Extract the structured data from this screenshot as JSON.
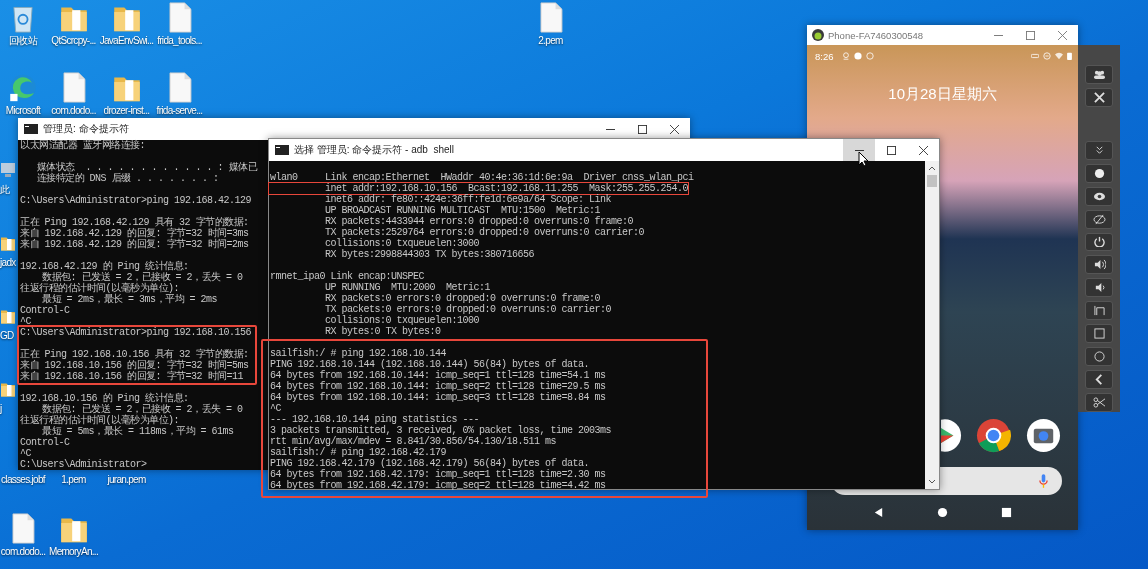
{
  "desktop": {
    "icons": [
      {
        "label": "回收站",
        "kind": "recycle"
      },
      {
        "label": "QtScrcpy-...",
        "kind": "folder"
      },
      {
        "label": "JavaEnvSwi...",
        "kind": "folder"
      },
      {
        "label": "frida_tools...",
        "kind": "file"
      },
      {
        "label": "2.pem",
        "kind": "file"
      },
      {
        "label": "Microsoft",
        "kind": "edge"
      },
      {
        "label": "com.dodo...",
        "kind": "file"
      },
      {
        "label": "drozer-inst...",
        "kind": "folder"
      },
      {
        "label": "frida-serve...",
        "kind": "file"
      },
      {
        "label": "此",
        "kind": "pc"
      },
      {
        "label": "jadx",
        "kind": "folder"
      },
      {
        "label": "GD",
        "kind": "folder"
      },
      {
        "label": "j",
        "kind": "folder"
      },
      {
        "label": "classes.jobf"
      },
      {
        "label": "1.pem"
      },
      {
        "label": "juran.pem"
      },
      {
        "label": "com.dodo...",
        "kind": "file"
      },
      {
        "label": "MemoryAn...",
        "kind": "folder"
      }
    ]
  },
  "cmd_window": {
    "title": "管理员: 命令提示符",
    "blocks": [
      [
        "以太网适配器 蓝牙网络连接:"
      ],
      [
        "   媒体状态  . . . . . . . . . . . . : 媒体已",
        "   连接特定的 DNS 后缀 . . . . . . . :"
      ],
      [
        "C:\\Users\\Administrator>ping 192.168.42.129"
      ],
      [
        "正在 Ping 192.168.42.129 具有 32 字节的数据:",
        "来自 192.168.42.129 的回复: 字节=32 时间=3ms",
        "来自 192.168.42.129 的回复: 字节=32 时间=2ms"
      ],
      [
        "192.168.42.129 的 Ping 统计信息:",
        "    数据包: 已发送 = 2，已接收 = 2，丢失 = 0",
        "往返行程的估计时间(以毫秒为单位):",
        "    最短 = 2ms，最长 = 3ms，平均 = 2ms",
        "Control-C",
        "^C",
        "C:\\Users\\Administrator>ping 192.168.10.156"
      ],
      [
        "正在 Ping 192.168.10.156 具有 32 字节的数据:",
        "来自 192.168.10.156 的回复: 字节=32 时间=5ms",
        "来自 192.168.10.156 的回复: 字节=32 时间=11"
      ],
      [
        "192.168.10.156 的 Ping 统计信息:",
        "    数据包: 已发送 = 2，已接收 = 2，丢失 = 0",
        "往返行程的估计时间(以毫秒为单位):",
        "    最短 = 5ms，最长 = 118ms，平均 = 61ms",
        "Control-C",
        "^C",
        "C:\\Users\\Administrator>"
      ]
    ]
  },
  "adb_window": {
    "title": "选择 管理员: 命令提示符 - adb  shell",
    "minimize_hovered": true,
    "blocks": [
      [
        "wlan0     Link encap:Ethernet  HWaddr 40:4e:36:1d:6e:9a  Driver cnss_wlan_pci",
        "          inet addr:192.168.10.156  Bcast:192.168.11.255  Mask:255.255.254.0",
        "          inet6 addr: fe80::424e:36ff:fe1d:6e9a/64 Scope: Link",
        "          UP BROADCAST RUNNING MULTICAST  MTU:1500  Metric:1",
        "          RX packets:4433944 errors:0 dropped:0 overruns:0 frame:0",
        "          TX packets:2529764 errors:0 dropped:0 overruns:0 carrier:0",
        "          collisions:0 txqueuelen:3000",
        "          RX bytes:2998844303 TX bytes:380716656"
      ],
      [
        "rmnet_ipa0 Link encap:UNSPEC",
        "          UP RUNNING  MTU:2000  Metric:1",
        "          RX packets:0 errors:0 dropped:0 overruns:0 frame:0",
        "          TX packets:0 errors:0 dropped:0 overruns:0 carrier:0",
        "          collisions:0 txqueuelen:1000",
        "          RX bytes:0 TX bytes:0"
      ],
      [
        "sailfish:/ # ping 192.168.10.144",
        "PING 192.168.10.144 (192.168.10.144) 56(84) bytes of data.",
        "64 bytes from 192.168.10.144: icmp_seq=1 ttl=128 time=54.1 ms",
        "64 bytes from 192.168.10.144: icmp_seq=2 ttl=128 time=29.5 ms",
        "64 bytes from 192.168.10.144: icmp_seq=3 ttl=128 time=8.84 ms",
        "^C",
        "--- 192.168.10.144 ping statistics ---",
        "3 packets transmitted, 3 received, 0% packet loss, time 2003ms",
        "rtt min/avg/max/mdev = 8.841/30.856/54.130/18.511 ms",
        "sailfish:/ # ping 192.168.42.179",
        "PING 192.168.42.179 (192.168.42.179) 56(84) bytes of data.",
        "64 bytes from 192.168.42.179: icmp_seq=1 ttl=128 time=2.30 ms",
        "64 bytes from 192.168.42.179: icmp_seq=2 ttl=128 time=4.42 ms"
      ]
    ]
  },
  "phone_window": {
    "title": "Phone-FA7460300548",
    "status_time": "8:26",
    "date": "10月28日星期六"
  }
}
